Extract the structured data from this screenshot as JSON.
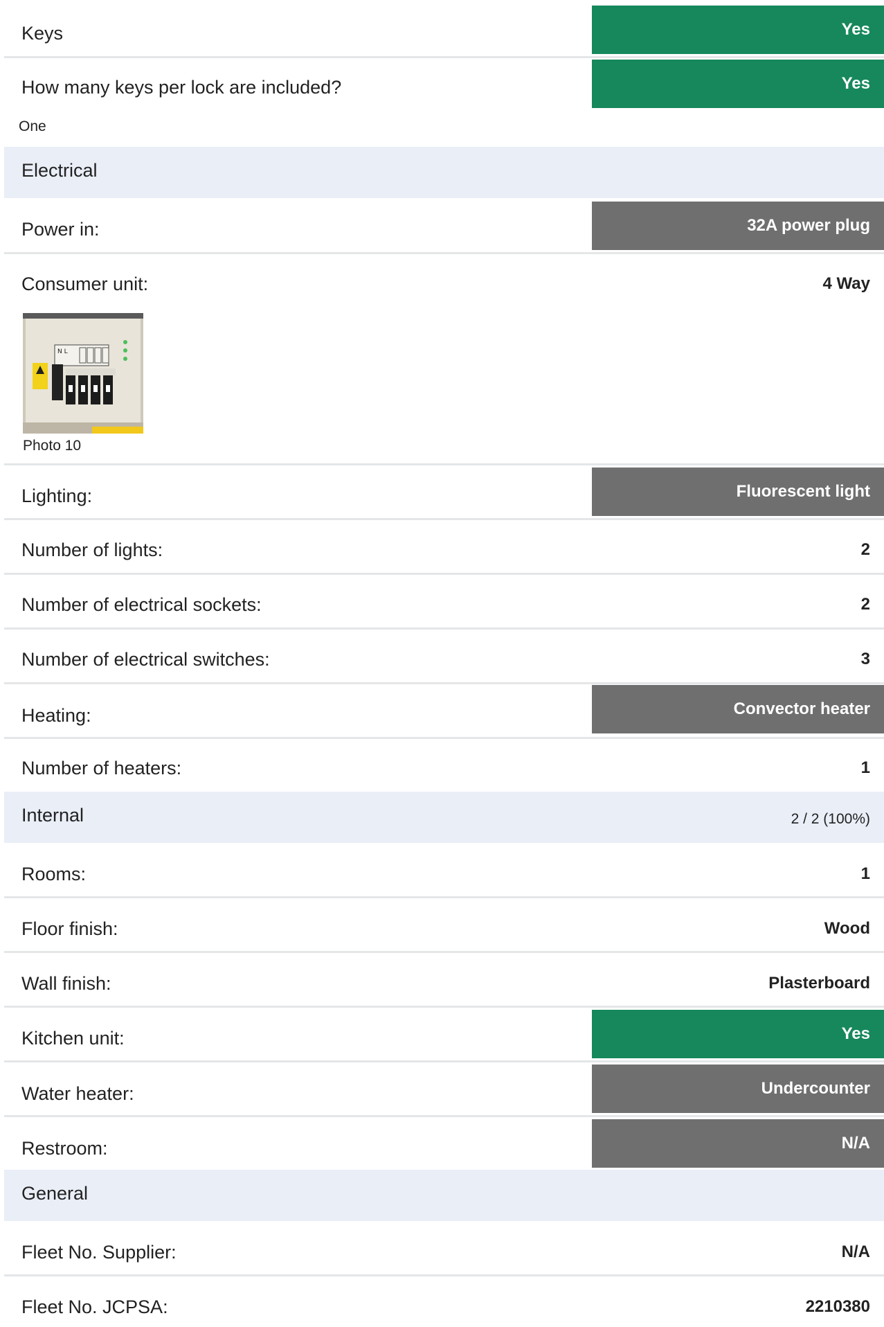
{
  "rows": {
    "keys": {
      "label": "Keys",
      "value": "Yes"
    },
    "keys_per_lock": {
      "label": "How many keys per lock are included?",
      "value": "Yes",
      "note": "One"
    },
    "electrical_section": {
      "label": "Electrical"
    },
    "power_in": {
      "label": "Power in:",
      "value": "32A power plug"
    },
    "consumer_unit": {
      "label": "Consumer unit:",
      "value": "4 Way",
      "photo_caption": "Photo 10"
    },
    "lighting": {
      "label": "Lighting:",
      "value": "Fluorescent light"
    },
    "number_of_lights": {
      "label": "Number of lights:",
      "value": "2"
    },
    "electrical_sockets": {
      "label": "Number of electrical sockets:",
      "value": "2"
    },
    "electrical_switches": {
      "label": "Number of electrical switches:",
      "value": "3"
    },
    "heating": {
      "label": "Heating:",
      "value": "Convector heater"
    },
    "number_of_heaters": {
      "label": "Number of heaters:",
      "value": "1"
    },
    "internal_section": {
      "label": "Internal",
      "progress": "2 / 2 (100%)"
    },
    "rooms": {
      "label": "Rooms:",
      "value": "1"
    },
    "floor_finish": {
      "label": "Floor finish:",
      "value": "Wood"
    },
    "wall_finish": {
      "label": "Wall finish:",
      "value": "Plasterboard"
    },
    "kitchen_unit": {
      "label": "Kitchen unit:",
      "value": "Yes"
    },
    "water_heater": {
      "label": "Water heater:",
      "value": "Undercounter"
    },
    "restroom": {
      "label": "Restroom:",
      "value": "N/A"
    },
    "general_section": {
      "label": "General"
    },
    "fleet_supplier": {
      "label": "Fleet No. Supplier:",
      "value": "N/A"
    },
    "fleet_jcpsa": {
      "label": "Fleet No. JCPSA:",
      "value": "2210380"
    }
  },
  "colors": {
    "badge_green": "#16885c",
    "badge_grey": "#6f6f6f",
    "section_background": "#e9eef7",
    "divider": "#e4e6e8"
  }
}
